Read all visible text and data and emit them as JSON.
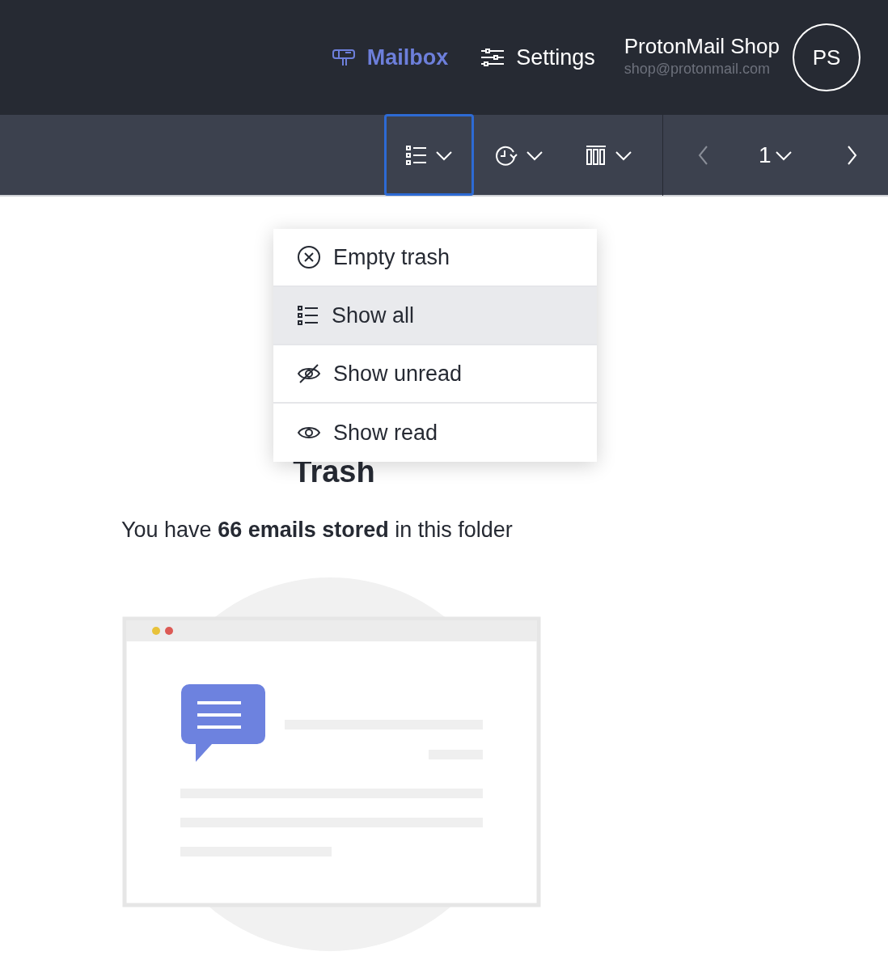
{
  "nav": [
    {
      "label": "Mailbox",
      "selected": true
    },
    {
      "label": "Settings",
      "selected": false
    }
  ],
  "user": {
    "name": "ProtonMail Shop",
    "email": "shop@protonmail.com",
    "initials": "PS"
  },
  "toolbar": [
    {
      "expanded": true
    },
    {
      "expanded": false
    },
    {
      "expanded": false
    }
  ],
  "pagination": {
    "page": "1"
  },
  "menu": [
    {
      "label": "Empty trash",
      "selected": false
    },
    {
      "label": "Show all",
      "selected": true
    },
    {
      "label": "Show unread",
      "selected": false
    },
    {
      "label": "Show read",
      "selected": false
    }
  ],
  "empty_state": {
    "title": "Trash",
    "message": "You have **66 emails stored** in this folder"
  }
}
